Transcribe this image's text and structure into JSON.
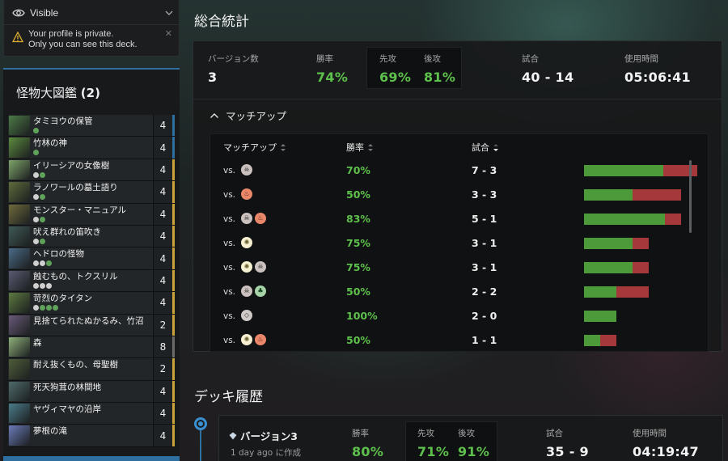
{
  "visibility": {
    "label": "Visible",
    "warning_line1": "Your profile is private.",
    "warning_line2": "Only you can see this deck."
  },
  "deck": {
    "title": "怪物大図鑑",
    "count": "(2)",
    "cards": [
      {
        "name": "タミヨウの保管",
        "mana": [
          "g"
        ],
        "count": "4",
        "color": "#4c7a45",
        "rarity": "#2f6fa0"
      },
      {
        "name": "竹林の神",
        "mana": [
          "g"
        ],
        "count": "4",
        "color": "#5b8a3e",
        "rarity": "#2f6fa0"
      },
      {
        "name": "イリーシアの女像樹",
        "mana": [
          "w",
          "g"
        ],
        "count": "4",
        "color": "#7fa56a",
        "rarity": "#c9a33a"
      },
      {
        "name": "ラノワールの墓土語り",
        "mana": [
          "w",
          "g"
        ],
        "count": "4",
        "color": "#5e6b3b",
        "rarity": "#c9a33a"
      },
      {
        "name": "モンスター・マニュアル",
        "mana": [
          "w",
          "g"
        ],
        "count": "4",
        "color": "#6f6a3c",
        "rarity": "#c9a33a"
      },
      {
        "name": "吠え群れの笛吹き",
        "mana": [
          "w",
          "g"
        ],
        "count": "4",
        "color": "#3f5a55",
        "rarity": "#c9a33a"
      },
      {
        "name": "ヘドロの怪物",
        "mana": [
          "w",
          "w",
          "g"
        ],
        "count": "4",
        "color": "#4a6a86",
        "rarity": "#c9a33a"
      },
      {
        "name": "蝕むもの、トクスリル",
        "mana": [
          "w",
          "w",
          "w"
        ],
        "count": "4",
        "color": "#5a5a72",
        "rarity": "#c9a33a"
      },
      {
        "name": "苛烈のタイタン",
        "mana": [
          "w",
          "g",
          "g",
          "g"
        ],
        "count": "4",
        "color": "#5d7a40",
        "rarity": "#c9a33a"
      },
      {
        "name": "見捨てられたぬかるみ、竹沼",
        "mana": [],
        "count": "2",
        "color": "#6a5a7a",
        "rarity": "#c9a33a"
      },
      {
        "name": "森",
        "mana": [],
        "count": "8",
        "color": "#8fb07a",
        "rarity": "#6a6a6a"
      },
      {
        "name": "耐え抜くもの、母聖樹",
        "mana": [],
        "count": "2",
        "color": "#4f5d3a",
        "rarity": "#c9a33a"
      },
      {
        "name": "死天狗茸の林間地",
        "mana": [],
        "count": "4",
        "color": "#4f6a6a",
        "rarity": "#c9a33a"
      },
      {
        "name": "ヤヴィマヤの沿岸",
        "mana": [],
        "count": "4",
        "color": "#4a7c8a",
        "rarity": "#c9a33a"
      },
      {
        "name": "夢根の滝",
        "mana": [],
        "count": "4",
        "color": "#6a7ab8",
        "rarity": "#c9a33a"
      }
    ]
  },
  "overall": {
    "heading": "総合統計",
    "versions_label": "バージョン数",
    "versions_value": "3",
    "winrate_label": "勝率",
    "winrate_value": "74%",
    "play_label": "先攻",
    "play_value": "69%",
    "draw_label": "後攻",
    "draw_value": "81%",
    "games_label": "試合",
    "games_value": "40 - 14",
    "time_label": "使用時間",
    "time_value": "05:06:41"
  },
  "matchup": {
    "toggle_label": "マッチアップ",
    "col_matchup": "マッチアップ",
    "col_winrate": "勝率",
    "col_games": "試合",
    "vs_text": "vs.",
    "rows": [
      {
        "colors": [
          "B"
        ],
        "winrate": "70%",
        "record": "7 - 3",
        "wins": 7,
        "losses": 3
      },
      {
        "colors": [
          "R"
        ],
        "winrate": "50%",
        "record": "3 - 3",
        "wins": 3,
        "losses": 3
      },
      {
        "colors": [
          "B",
          "R"
        ],
        "winrate": "83%",
        "record": "5 - 1",
        "wins": 5,
        "losses": 1
      },
      {
        "colors": [
          "W"
        ],
        "winrate": "75%",
        "record": "3 - 1",
        "wins": 3,
        "losses": 1
      },
      {
        "colors": [
          "W",
          "B"
        ],
        "winrate": "75%",
        "record": "3 - 1",
        "wins": 3,
        "losses": 1
      },
      {
        "colors": [
          "B",
          "G"
        ],
        "winrate": "50%",
        "record": "2 - 2",
        "wins": 2,
        "losses": 2
      },
      {
        "colors": [
          "C"
        ],
        "winrate": "100%",
        "record": "2 - 0",
        "wins": 2,
        "losses": 0
      },
      {
        "colors": [
          "W",
          "R"
        ],
        "winrate": "50%",
        "record": "1 - 1",
        "wins": 1,
        "losses": 1
      }
    ]
  },
  "history": {
    "heading": "デッキ履歴",
    "version": "バージョン3",
    "created": "1 day ago に作成",
    "winrate_label": "勝率",
    "winrate_value": "80%",
    "play_label": "先攻",
    "play_value": "71%",
    "draw_label": "後攻",
    "draw_value": "91%",
    "games_label": "試合",
    "games_value": "35 - 9",
    "time_label": "使用時間",
    "time_value": "04:19:47"
  },
  "colors": {
    "accent_blue": "#3a8fd0",
    "win_green": "#5ec04c",
    "bar_win": "#4d9a3a",
    "bar_loss": "#a4383b"
  }
}
